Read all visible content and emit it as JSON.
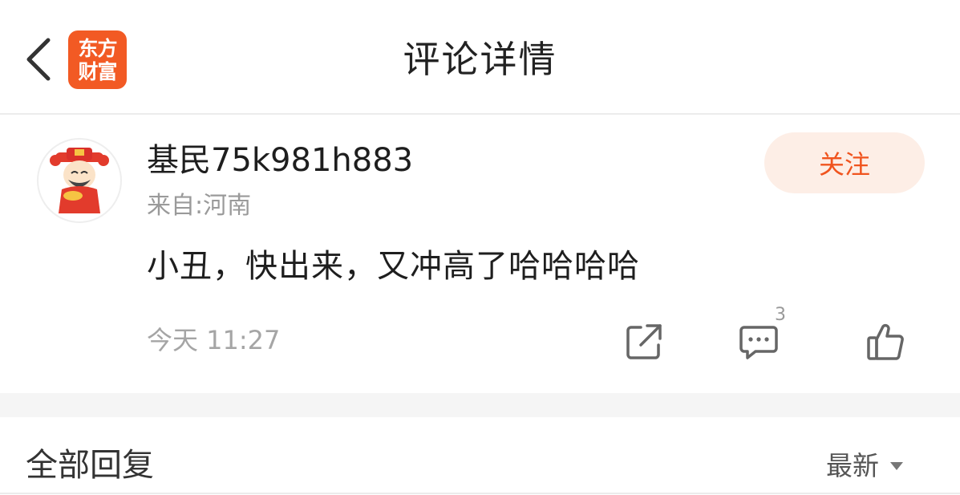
{
  "header": {
    "title": "评论详情",
    "logo_line1": "东方",
    "logo_line2": "财富"
  },
  "comment": {
    "username": "基民75k981h883",
    "location": "来自:河南",
    "follow_label": "关注",
    "text": "小丑，快出来，又冲高了哈哈哈哈",
    "time": "今天 11:27",
    "reply_count": "3"
  },
  "replies": {
    "title": "全部回复",
    "sort_label": "最新"
  },
  "colors": {
    "brand": "#f25a24",
    "follow_bg": "#fdeee6",
    "follow_text": "#f0541e"
  },
  "icons": [
    "back-icon",
    "app-logo",
    "avatar",
    "share-icon",
    "comment-icon",
    "thumbs-up-icon",
    "caret-down-icon"
  ]
}
